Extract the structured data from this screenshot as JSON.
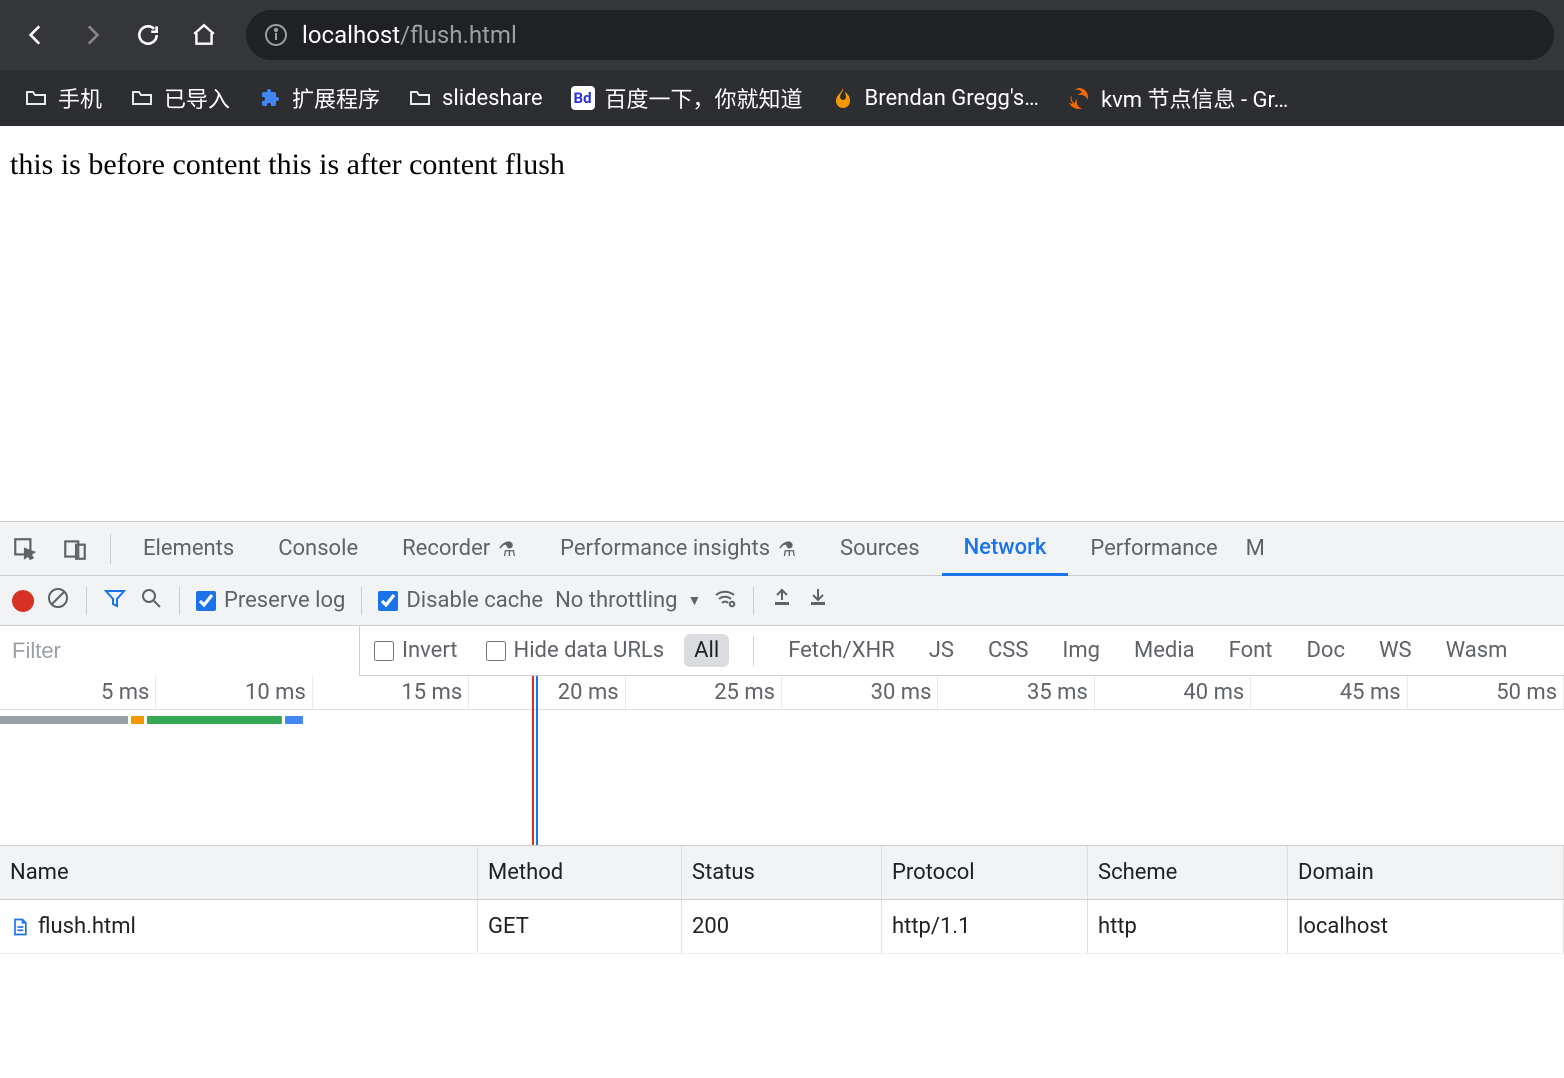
{
  "browser": {
    "url_host": "localhost",
    "url_path": "/flush.html",
    "bookmarks": [
      {
        "label": "手机",
        "icon": "folder"
      },
      {
        "label": "已导入",
        "icon": "folder"
      },
      {
        "label": "扩展程序",
        "icon": "puzzle"
      },
      {
        "label": "slideshare",
        "icon": "folder"
      },
      {
        "label": "百度一下，你就知道",
        "icon": "baidu"
      },
      {
        "label": "Brendan Gregg's…",
        "icon": "flame"
      },
      {
        "label": "kvm 节点信息 - Gr…",
        "icon": "grafana"
      }
    ]
  },
  "page": {
    "body_text": "this is before content this is after content flush"
  },
  "devtools": {
    "tabs": {
      "elements": "Elements",
      "console": "Console",
      "recorder": "Recorder",
      "perf_insights": "Performance insights",
      "sources": "Sources",
      "network": "Network",
      "performance": "Performance",
      "more": "M"
    },
    "network_toolbar": {
      "preserve_log": "Preserve log",
      "disable_cache": "Disable cache",
      "throttling": "No throttling"
    },
    "filter_row": {
      "placeholder": "Filter",
      "invert": "Invert",
      "hide_data_urls": "Hide data URLs",
      "types": [
        "All",
        "Fetch/XHR",
        "JS",
        "CSS",
        "Img",
        "Media",
        "Font",
        "Doc",
        "WS",
        "Wasm"
      ],
      "active_type": "All"
    },
    "overview": {
      "ticks": [
        "5 ms",
        "10 ms",
        "15 ms",
        "20 ms",
        "25 ms",
        "30 ms",
        "35 ms",
        "40 ms",
        "45 ms",
        "50 ms"
      ],
      "playhead_ms": 20
    },
    "columns": {
      "name": "Name",
      "method": "Method",
      "status": "Status",
      "protocol": "Protocol",
      "scheme": "Scheme",
      "domain": "Domain"
    },
    "requests": [
      {
        "name": "flush.html",
        "method": "GET",
        "status": "200",
        "protocol": "http/1.1",
        "scheme": "http",
        "domain": "localhost"
      }
    ]
  }
}
